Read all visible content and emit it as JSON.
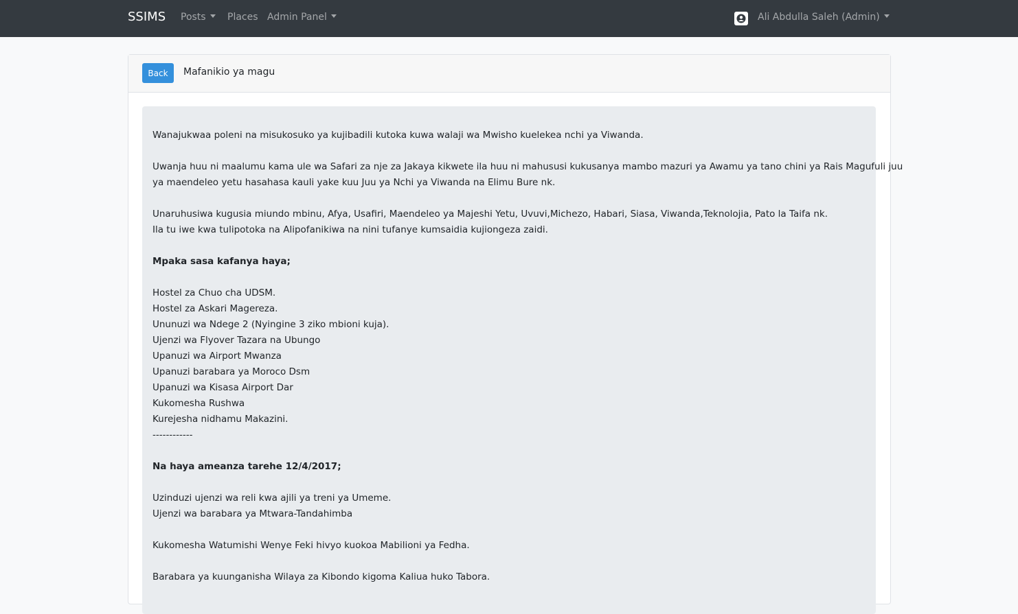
{
  "navbar": {
    "brand": "SSIMS",
    "posts": "Posts",
    "places": "Places",
    "admin_panel": "Admin Panel",
    "user": "Ali Abdulla Saleh (Admin)"
  },
  "post": {
    "back_label": "Back",
    "title": "Mafanikio ya magu",
    "lines": [
      "Wanajukwaa poleni na misukosuko ya kujibadili kutoka kuwa walaji wa Mwisho kuelekea nchi ya Viwanda.",
      "Uwanja huu ni maalumu kama ule wa Safari za nje za Jakaya kikwete ila huu ni mahususi kukusanya mambo mazuri ya Awamu ya tano chini ya Rais Magufuli juu",
      "ya maendeleo yetu hasahasa kauli yake kuu Juu ya Nchi ya Viwanda na Elimu Bure nk.",
      "Unaruhusiwa kugusia miundo mbinu, Afya, Usafiri, Maendeleo ya Majeshi Yetu, Uvuvi,Michezo, Habari, Siasa, Viwanda,Teknolojia, Pato la Taifa nk.",
      "Ila tu iwe kwa tulipotoka na Alipofanikiwa na nini tufanye kumsaidia kujiongeza zaidi.",
      "Mpaka sasa kafanya haya;",
      "Hostel za Chuo cha UDSM.",
      "Hostel za Askari Magereza.",
      "Ununuzi wa Ndege 2 (Nyingine 3 ziko mbioni kuja).",
      "Ujenzi wa Flyover Tazara na Ubungo",
      "Upanuzi wa Airport Mwanza",
      "Upanuzi barabara ya Moroco Dsm",
      "Upanuzi wa Kisasa Airport Dar",
      "Kukomesha Rushwa",
      "Kurejesha nidhamu Makazini.",
      "------------",
      "Na haya ameanza tarehe 12/4/2017;",
      "Uzinduzi ujenzi wa reli kwa ajili ya treni ya Umeme.",
      "Ujenzi wa barabara ya Mtwara-Tandahimba",
      "Kukomesha Watumishi Wenye Feki hivyo kuokoa Mabilioni ya Fedha.",
      "Barabara ya kuunganisha Wilaya za Kibondo kigoma Kaliua huko Tabora."
    ]
  }
}
